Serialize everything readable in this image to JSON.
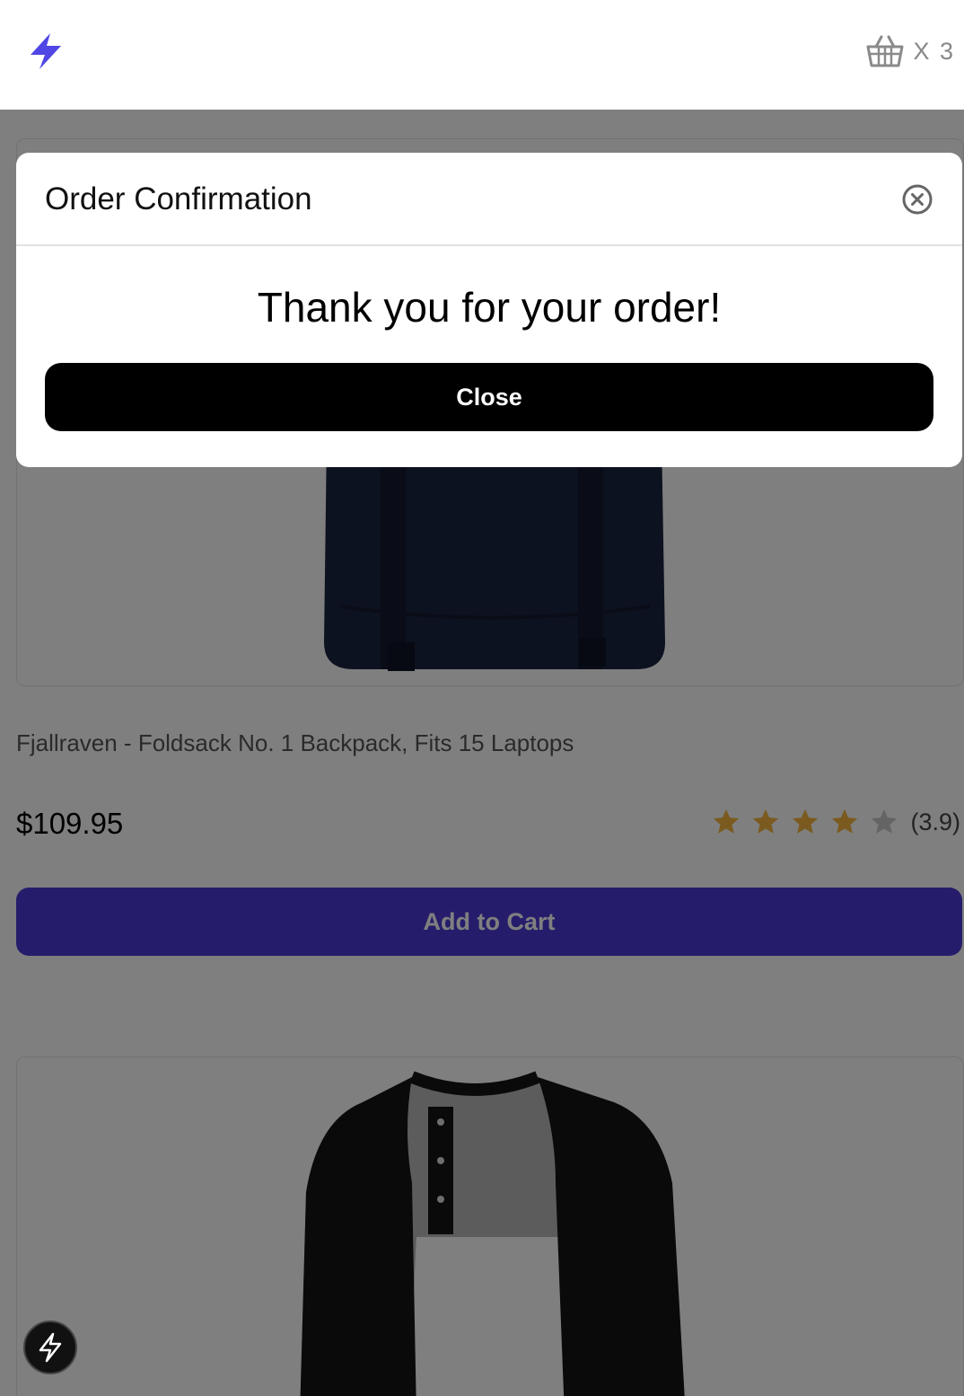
{
  "header": {
    "logo_icon": "bolt-icon",
    "cart_icon": "basket-icon",
    "cart_count": "X 3",
    "accent_color": "#4f46e5"
  },
  "product": {
    "title": "Fjallraven - Foldsack No. 1 Backpack, Fits 15 Laptops",
    "price": "$109.95",
    "rating_value": 3.9,
    "rating_label": "(3.9)",
    "rating_max": 5,
    "add_to_cart_label": "Add to Cart",
    "image_icon": "backpack-image"
  },
  "next_product": {
    "image_icon": "henley-shirt-image"
  },
  "modal": {
    "title": "Order Confirmation",
    "message": "Thank you for your order!",
    "close_label": "Close",
    "close_icon": "close-circle-icon"
  },
  "floating_button": {
    "icon": "bolt-icon"
  }
}
